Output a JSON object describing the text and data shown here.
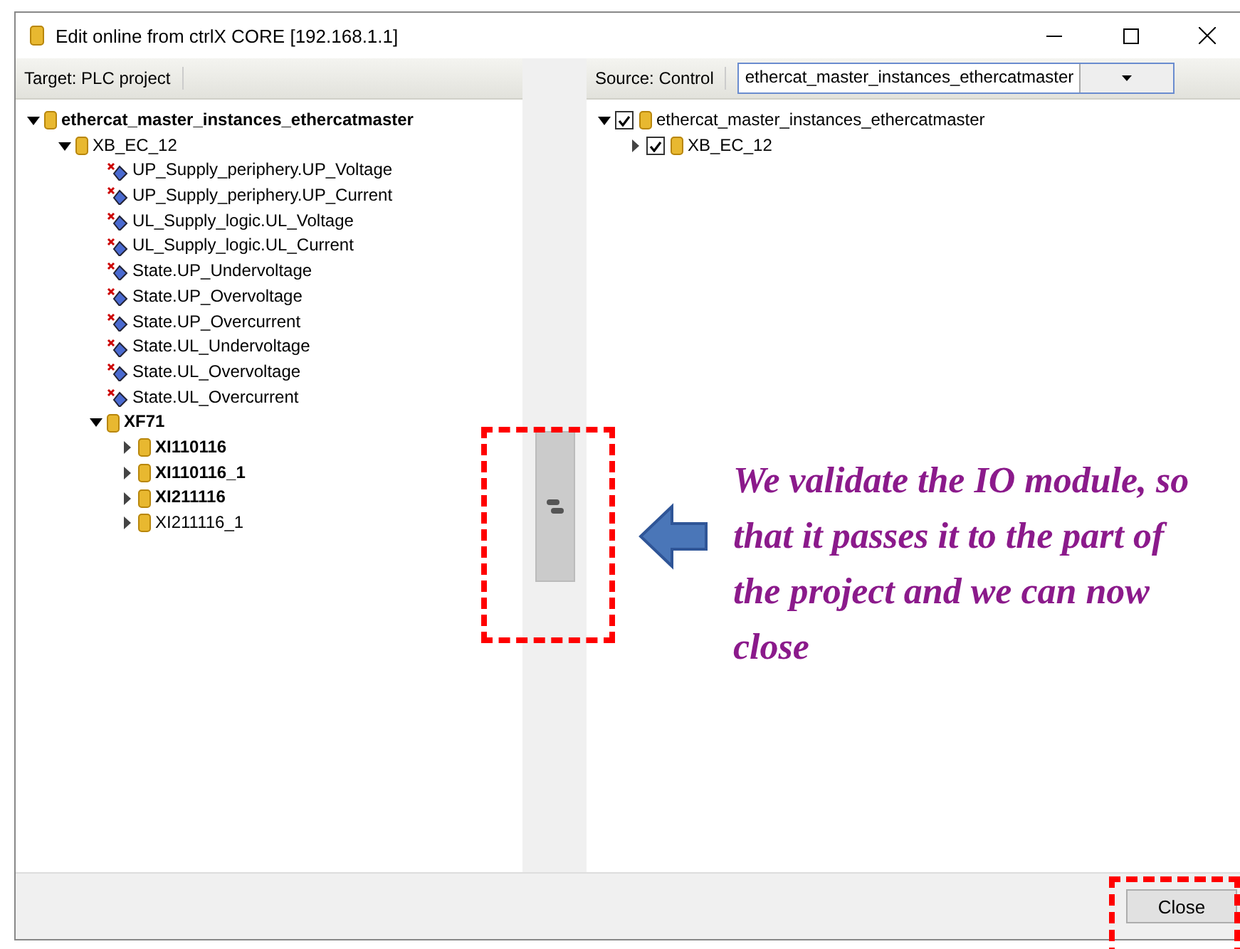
{
  "window": {
    "title": "Edit online from ctrlX CORE [192.168.1.1]"
  },
  "left_pane": {
    "label": "Target: PLC project",
    "tree": [
      {
        "kind": "folder",
        "label": "ethercat_master_instances_ethercatmaster",
        "bold": true,
        "expanded": true,
        "children": [
          {
            "kind": "folder",
            "label": "XB_EC_12",
            "bold": false,
            "expanded": true,
            "children": [
              {
                "kind": "variable",
                "label": "UP_Supply_periphery.UP_Voltage",
                "bold": false
              },
              {
                "kind": "variable",
                "label": "UP_Supply_periphery.UP_Current",
                "bold": false
              },
              {
                "kind": "variable",
                "label": "UL_Supply_logic.UL_Voltage",
                "bold": false
              },
              {
                "kind": "variable",
                "label": "UL_Supply_logic.UL_Current",
                "bold": false
              },
              {
                "kind": "variable",
                "label": "State.UP_Undervoltage",
                "bold": false
              },
              {
                "kind": "variable",
                "label": "State.UP_Overvoltage",
                "bold": false
              },
              {
                "kind": "variable",
                "label": "State.UP_Overcurrent",
                "bold": false
              },
              {
                "kind": "variable",
                "label": "State.UL_Undervoltage",
                "bold": false
              },
              {
                "kind": "variable",
                "label": "State.UL_Overvoltage",
                "bold": false
              },
              {
                "kind": "variable",
                "label": "State.UL_Overcurrent",
                "bold": false
              },
              {
                "kind": "folder",
                "label": "XF71",
                "bold": true,
                "expanded": true,
                "children": [
                  {
                    "kind": "folder",
                    "label": "XI110116",
                    "bold": true,
                    "expanded": false
                  },
                  {
                    "kind": "folder",
                    "label": "XI110116_1",
                    "bold": true,
                    "expanded": false
                  },
                  {
                    "kind": "folder",
                    "label": "XI211116",
                    "bold": true,
                    "expanded": false
                  },
                  {
                    "kind": "folder",
                    "label": "XI211116_1",
                    "bold": false,
                    "expanded": false
                  }
                ]
              }
            ]
          }
        ]
      }
    ]
  },
  "right_pane": {
    "label": "Source: Control",
    "dropdown": {
      "value": "ethercat_master_instances_ethercatmaster"
    },
    "tree": [
      {
        "kind": "folder",
        "label": "ethercat_master_instances_ethercatmaster",
        "bold": false,
        "expanded": true,
        "checked": true,
        "children": [
          {
            "kind": "folder",
            "label": "XB_EC_12",
            "bold": false,
            "expanded": false,
            "checked": true
          }
        ]
      }
    ]
  },
  "callout": "We validate the IO module, so that it passes it to the part of the project and we can now close",
  "buttons": [
    "Close"
  ]
}
